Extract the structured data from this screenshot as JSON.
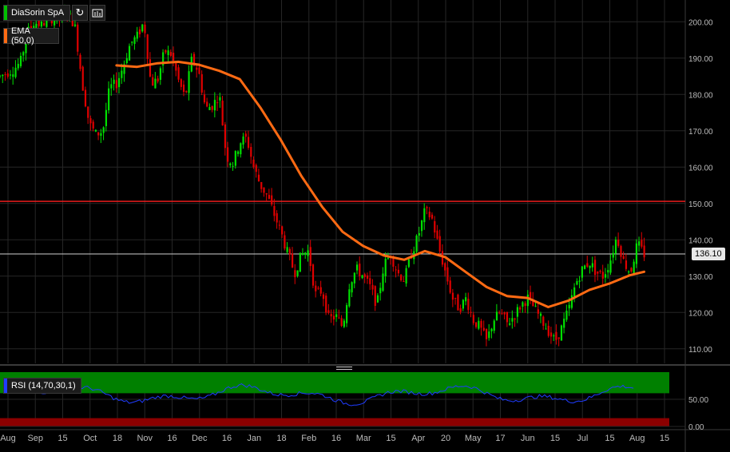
{
  "colors": {
    "up": "#00e000",
    "down": "#e00000",
    "ema": "#ff6a13",
    "hline": "#e81c1c",
    "last_line": "#cfcfcf",
    "rsi_line": "#1f3cff",
    "rsi_over": "#008000",
    "rsi_under": "#8b0000",
    "grid": "#262626"
  },
  "toolbar": {
    "symbol_label": "DiaSorin SpA",
    "refresh_icon": "refresh-icon",
    "indicators_icon": "indicators-icon"
  },
  "last_price_label": "136.10",
  "chart_data": [
    {
      "type": "candlestick",
      "series": [
        {
          "name": "DiaSorin SpA",
          "kind": "ohlc"
        },
        {
          "name": "EMA (50,0)",
          "kind": "line"
        }
      ],
      "y_ticks": [
        "200.00",
        "190.00",
        "180.00",
        "170.00",
        "160.00",
        "150.00",
        "140.00",
        "130.00",
        "120.00",
        "110.00"
      ],
      "ylim": [
        106,
        206
      ],
      "x_tick_labels": [
        "Aug",
        "Sep",
        "15",
        "Oct",
        "18",
        "Nov",
        "16",
        "Dec",
        "16",
        "Jan",
        "18",
        "Feb",
        "16",
        "Mar",
        "15",
        "Apr",
        "20",
        "May",
        "17",
        "Jun",
        "15",
        "Jul",
        "15",
        "Aug",
        "15"
      ],
      "horizontal_line": 150.6,
      "last_price": 136.1,
      "ema_points": [
        [
          0.17,
          188.0
        ],
        [
          0.2,
          187.6
        ],
        [
          0.23,
          188.6
        ],
        [
          0.26,
          189.0
        ],
        [
          0.29,
          188.2
        ],
        [
          0.32,
          186.5
        ],
        [
          0.35,
          184.2
        ],
        [
          0.38,
          176.4
        ],
        [
          0.41,
          167.4
        ],
        [
          0.44,
          157.5
        ],
        [
          0.47,
          149.1
        ],
        [
          0.5,
          142.2
        ],
        [
          0.53,
          138.3
        ],
        [
          0.56,
          135.7
        ],
        [
          0.59,
          134.5
        ],
        [
          0.62,
          136.9
        ],
        [
          0.65,
          135.2
        ],
        [
          0.68,
          131.1
        ],
        [
          0.71,
          127.0
        ],
        [
          0.74,
          124.5
        ],
        [
          0.77,
          124.0
        ],
        [
          0.8,
          121.5
        ],
        [
          0.83,
          123.3
        ],
        [
          0.86,
          126.2
        ],
        [
          0.89,
          128.0
        ],
        [
          0.92,
          130.3
        ],
        [
          0.94,
          131.2
        ]
      ],
      "price_path": [
        [
          0.0,
          185
        ],
        [
          0.02,
          187
        ],
        [
          0.03,
          189
        ],
        [
          0.04,
          197
        ],
        [
          0.05,
          200
        ],
        [
          0.06,
          199
        ],
        [
          0.07,
          201
        ],
        [
          0.09,
          201
        ],
        [
          0.1,
          203
        ],
        [
          0.11,
          198
        ],
        [
          0.12,
          183
        ],
        [
          0.13,
          172
        ],
        [
          0.14,
          169
        ],
        [
          0.15,
          170
        ],
        [
          0.16,
          182
        ],
        [
          0.17,
          183
        ],
        [
          0.18,
          188
        ],
        [
          0.19,
          194
        ],
        [
          0.2,
          196
        ],
        [
          0.21,
          200
        ],
        [
          0.22,
          183
        ],
        [
          0.23,
          184
        ],
        [
          0.24,
          192
        ],
        [
          0.25,
          191
        ],
        [
          0.26,
          184
        ],
        [
          0.27,
          179
        ],
        [
          0.28,
          190
        ],
        [
          0.29,
          186
        ],
        [
          0.3,
          176
        ],
        [
          0.31,
          177
        ],
        [
          0.32,
          180
        ],
        [
          0.33,
          163
        ],
        [
          0.34,
          161
        ],
        [
          0.35,
          167
        ],
        [
          0.36,
          168
        ],
        [
          0.37,
          160
        ],
        [
          0.38,
          155
        ],
        [
          0.39,
          152
        ],
        [
          0.4,
          147
        ],
        [
          0.41,
          142
        ],
        [
          0.42,
          136
        ],
        [
          0.43,
          131
        ],
        [
          0.44,
          136
        ],
        [
          0.45,
          137
        ],
        [
          0.46,
          125
        ],
        [
          0.47,
          126
        ],
        [
          0.48,
          118
        ],
        [
          0.49,
          119
        ],
        [
          0.5,
          116
        ],
        [
          0.51,
          128
        ],
        [
          0.52,
          132
        ],
        [
          0.53,
          130
        ],
        [
          0.54,
          127
        ],
        [
          0.55,
          122
        ],
        [
          0.56,
          133
        ],
        [
          0.57,
          136
        ],
        [
          0.58,
          131
        ],
        [
          0.59,
          129
        ],
        [
          0.6,
          136
        ],
        [
          0.61,
          141
        ],
        [
          0.62,
          148
        ],
        [
          0.63,
          146
        ],
        [
          0.64,
          138
        ],
        [
          0.65,
          131
        ],
        [
          0.66,
          124
        ],
        [
          0.67,
          121
        ],
        [
          0.68,
          124
        ],
        [
          0.69,
          118
        ],
        [
          0.7,
          116
        ],
        [
          0.71,
          112
        ],
        [
          0.72,
          118
        ],
        [
          0.73,
          120
        ],
        [
          0.74,
          117
        ],
        [
          0.75,
          119
        ],
        [
          0.76,
          122
        ],
        [
          0.77,
          124
        ],
        [
          0.78,
          121
        ],
        [
          0.79,
          118
        ],
        [
          0.8,
          115
        ],
        [
          0.81,
          112
        ],
        [
          0.82,
          116
        ],
        [
          0.83,
          121
        ],
        [
          0.84,
          128
        ],
        [
          0.85,
          132
        ],
        [
          0.86,
          134
        ],
        [
          0.87,
          131
        ],
        [
          0.88,
          130
        ],
        [
          0.89,
          134
        ],
        [
          0.9,
          141
        ],
        [
          0.91,
          134
        ],
        [
          0.92,
          131
        ],
        [
          0.93,
          139
        ],
        [
          0.94,
          136
        ]
      ]
    },
    {
      "type": "line",
      "series": [
        {
          "name": "RSI (14,70,30,1)"
        }
      ],
      "y_ticks": [
        "50.00",
        "0.00"
      ],
      "ylim": [
        0,
        100
      ],
      "overbought": 70,
      "oversold": 30
    }
  ]
}
